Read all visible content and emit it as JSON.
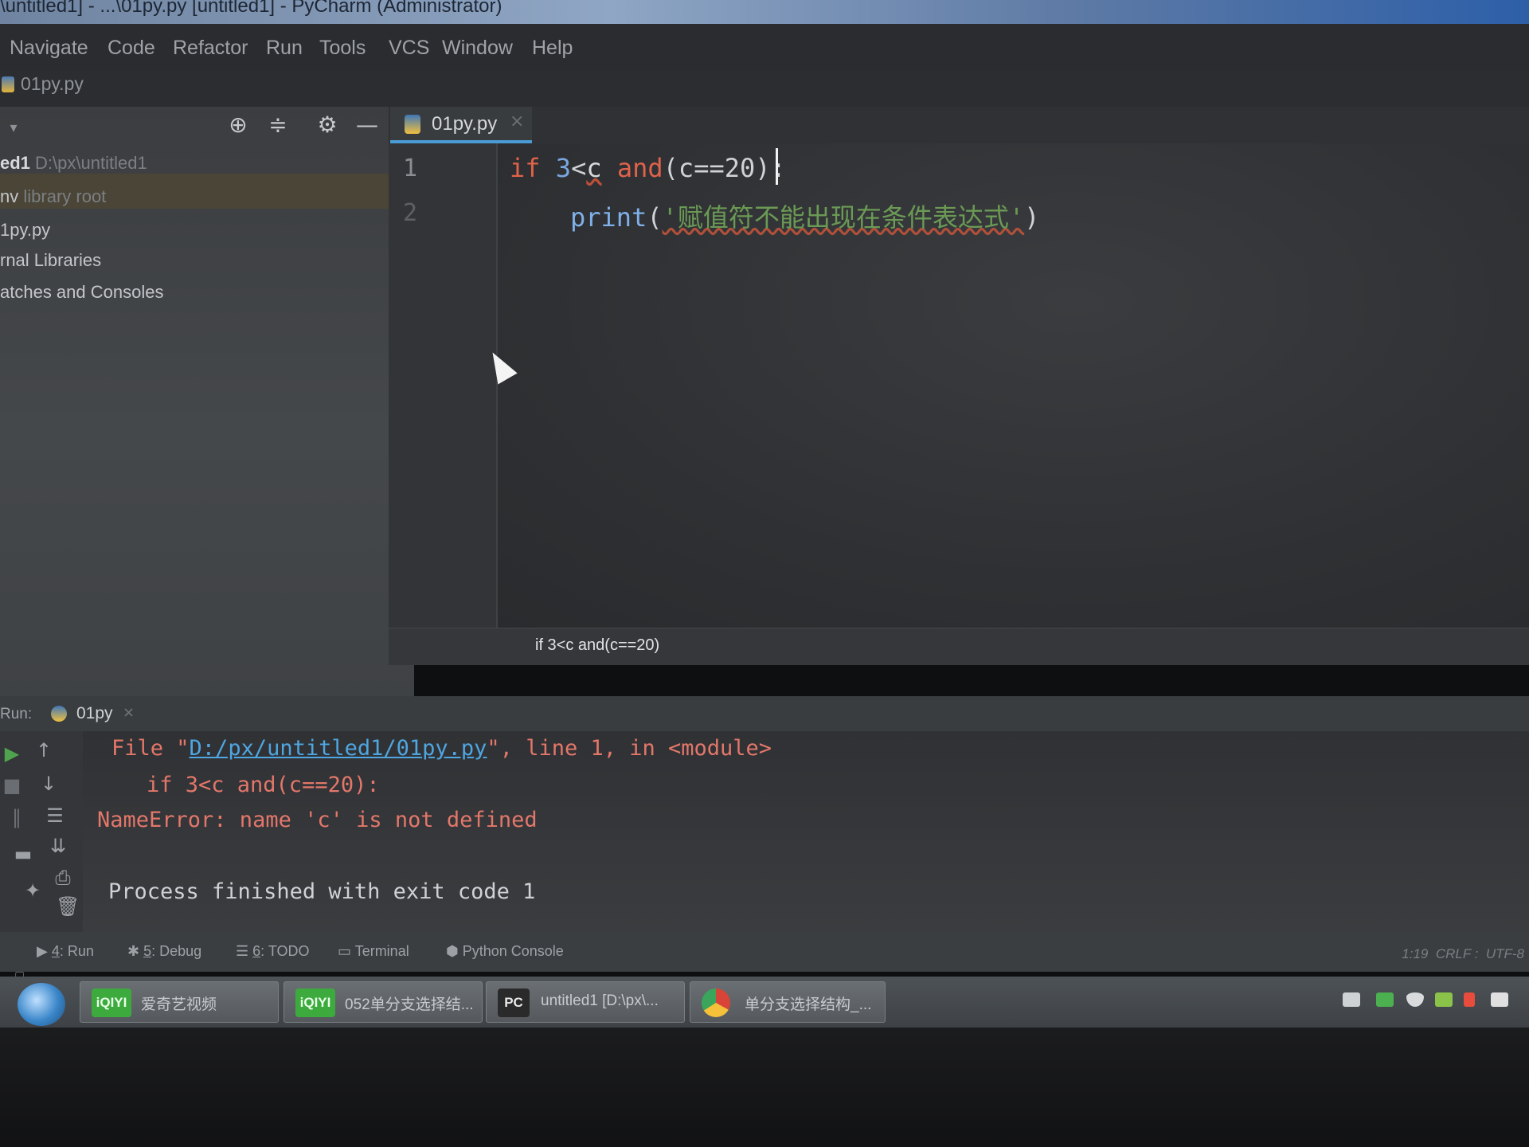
{
  "window": {
    "title": "\\untitled1] - ...\\01py.py [untitled1] - PyCharm (Administrator)"
  },
  "menu": [
    "Navigate",
    "Code",
    "Refactor",
    "Run",
    "Tools",
    "VCS",
    "Window",
    "Help"
  ],
  "navbar": {
    "file": "01py.py"
  },
  "project_panel": {
    "tree": [
      {
        "bold": "ed1",
        "muted": "D:\\px\\untitled1"
      },
      {
        "text": "nv",
        "muted": "library root"
      },
      {
        "text": "1py.py"
      },
      {
        "text": "rnal Libraries"
      },
      {
        "text": "atches and Consoles"
      }
    ],
    "toolbar_icons": [
      "target-icon",
      "collapse-icon",
      "gear-icon",
      "minimize-icon"
    ]
  },
  "editor": {
    "tab_label": "01py.py",
    "tab_close": "×",
    "line_numbers": [
      "1",
      "2"
    ],
    "line1": {
      "kw_if": "if",
      "num3": "3",
      "lt": "<",
      "c": "c",
      "kw_and": "and",
      "rest": "(c==20):"
    },
    "line2": {
      "fn": "print",
      "open": "(",
      "str": "'赋值符不能出现在条件表达式'",
      "close": ")"
    },
    "breadcrumb": "if 3<c and(c==20)"
  },
  "run_panel": {
    "label": "Run:",
    "tab_label": "01py",
    "tab_close": "×",
    "lines": {
      "file_prefix": "File \"",
      "file_link": "D:/px/untitled1/01py.py",
      "file_suffix": "\", line 1, in <module>",
      "source": "if 3<c and(c==20):",
      "error": "NameError: name 'c' is not defined",
      "finished": "Process finished with exit code 1"
    }
  },
  "tool_windows": [
    {
      "num": "4",
      "label": ": Run"
    },
    {
      "num": "5",
      "label": ": Debug"
    },
    {
      "num": "6",
      "label": ": TODO"
    },
    {
      "num": "",
      "label": "Terminal"
    },
    {
      "num": "",
      "label": "Python Console"
    }
  ],
  "status": {
    "position": "1:19",
    "line_sep": "CRLF :",
    "encoding": "UTF-8"
  },
  "taskbar": {
    "items": [
      {
        "icon": "iQIYI",
        "label": "爱奇艺视频"
      },
      {
        "icon": "iQIYI",
        "label": "052单分支选择结..."
      },
      {
        "icon": "PC",
        "label": "untitled1 [D:\\px\\..."
      },
      {
        "icon": "chrome-icon",
        "label": "单分支选择结构_..."
      }
    ]
  },
  "colors": {
    "keyword": "#e0624a",
    "number": "#7aa7e0",
    "string": "#6b9a55",
    "link": "#4fa6e0",
    "error": "#e3776a",
    "tab_accent": "#4a9bd6"
  }
}
